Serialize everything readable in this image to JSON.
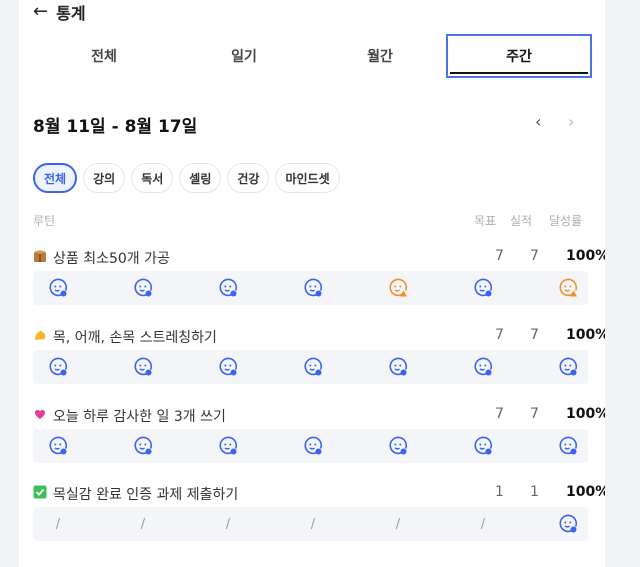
{
  "header": {
    "back_icon": "arrow-left-icon",
    "title": "통계"
  },
  "tabs": [
    {
      "label": "전체",
      "active": false
    },
    {
      "label": "일기",
      "active": false
    },
    {
      "label": "월간",
      "active": false
    },
    {
      "label": "주간",
      "active": true
    }
  ],
  "week_range": "8월 11일 - 8월 17일",
  "nav": {
    "prev": "‹",
    "next": "›"
  },
  "chips": [
    {
      "label": "전체",
      "active": true
    },
    {
      "label": "강의",
      "active": false
    },
    {
      "label": "독서",
      "active": false
    },
    {
      "label": "셀링",
      "active": false
    },
    {
      "label": "건강",
      "active": false
    },
    {
      "label": "마인드셋",
      "active": false
    }
  ],
  "columns": {
    "routine": "루틴",
    "goal": "목표",
    "actual": "실적",
    "rate": "달성률"
  },
  "colors": {
    "accent": "#3b63f0",
    "warn": "#f0902a"
  },
  "routines": [
    {
      "emoji": "package-icon",
      "title": "상품 최소50개 가공",
      "goal": "7",
      "actual": "7",
      "rate": "100%",
      "days": [
        "blue",
        "blue",
        "blue",
        "blue",
        "orange",
        "blue",
        "orange"
      ]
    },
    {
      "emoji": "flexed-biceps-icon",
      "title": "목, 어깨, 손목 스트레칭하기",
      "goal": "7",
      "actual": "7",
      "rate": "100%",
      "days": [
        "blue",
        "blue",
        "blue",
        "blue",
        "blue",
        "blue",
        "blue"
      ]
    },
    {
      "emoji": "pink-heart-icon",
      "title": "오늘 하루 감사한 일 3개 쓰기",
      "goal": "7",
      "actual": "7",
      "rate": "100%",
      "days": [
        "blue",
        "blue",
        "blue",
        "blue",
        "blue",
        "blue",
        "blue"
      ]
    },
    {
      "emoji": "check-box-icon",
      "title": "목실감 완료 인증 과제 제출하기",
      "goal": "1",
      "actual": "1",
      "rate": "100%",
      "days": [
        "slash",
        "slash",
        "slash",
        "slash",
        "slash",
        "slash",
        "blue"
      ]
    }
  ]
}
